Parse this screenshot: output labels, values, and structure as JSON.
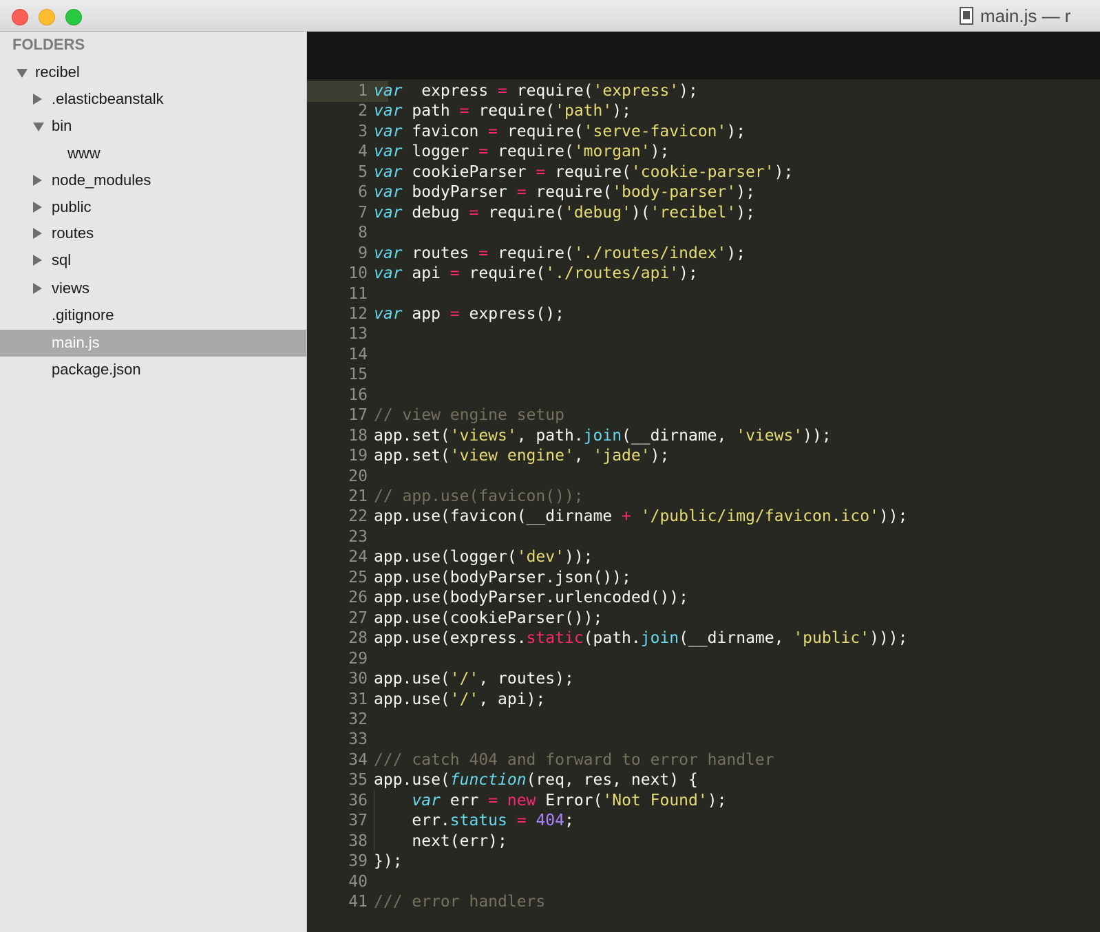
{
  "window": {
    "title": "main.js — r",
    "file_icon": "document-icon"
  },
  "sidebar": {
    "header": "FOLDERS",
    "items": [
      {
        "label": "recibel",
        "type": "folder",
        "expanded": true
      },
      {
        "label": ".elasticbeanstalk",
        "type": "folder",
        "expanded": false
      },
      {
        "label": "bin",
        "type": "folder",
        "expanded": true
      },
      {
        "label": "www",
        "type": "file"
      },
      {
        "label": "node_modules",
        "type": "folder",
        "expanded": false
      },
      {
        "label": "public",
        "type": "folder",
        "expanded": false
      },
      {
        "label": "routes",
        "type": "folder",
        "expanded": false
      },
      {
        "label": "sql",
        "type": "folder",
        "expanded": false
      },
      {
        "label": "views",
        "type": "folder",
        "expanded": false
      },
      {
        "label": ".gitignore",
        "type": "file"
      },
      {
        "label": "main.js",
        "type": "file",
        "selected": true
      },
      {
        "label": "package.json",
        "type": "file"
      }
    ]
  },
  "editor": {
    "theme_colors": {
      "background": "#272822",
      "keyword": "#66d9ef",
      "operator": "#f92672",
      "string": "#e6db74",
      "comment": "#75715e",
      "number": "#ae81ff"
    },
    "current_line": 1,
    "lines": [
      [
        [
          "kw",
          "var"
        ],
        [
          "",
          "  express "
        ],
        [
          "op",
          "="
        ],
        [
          "",
          " require("
        ],
        [
          "str",
          "'express'"
        ],
        [
          "",
          ");"
        ]
      ],
      [
        [
          "kw",
          "var"
        ],
        [
          "",
          " path "
        ],
        [
          "op",
          "="
        ],
        [
          "",
          " require("
        ],
        [
          "str",
          "'path'"
        ],
        [
          "",
          ");"
        ]
      ],
      [
        [
          "kw",
          "var"
        ],
        [
          "",
          " favicon "
        ],
        [
          "op",
          "="
        ],
        [
          "",
          " require("
        ],
        [
          "str",
          "'serve-favicon'"
        ],
        [
          "",
          ");"
        ]
      ],
      [
        [
          "kw",
          "var"
        ],
        [
          "",
          " logger "
        ],
        [
          "op",
          "="
        ],
        [
          "",
          " require("
        ],
        [
          "str",
          "'morgan'"
        ],
        [
          "",
          ");"
        ]
      ],
      [
        [
          "kw",
          "var"
        ],
        [
          "",
          " cookieParser "
        ],
        [
          "op",
          "="
        ],
        [
          "",
          " require("
        ],
        [
          "str",
          "'cookie-parser'"
        ],
        [
          "",
          ");"
        ]
      ],
      [
        [
          "kw",
          "var"
        ],
        [
          "",
          " bodyParser "
        ],
        [
          "op",
          "="
        ],
        [
          "",
          " require("
        ],
        [
          "str",
          "'body-parser'"
        ],
        [
          "",
          ");"
        ]
      ],
      [
        [
          "kw",
          "var"
        ],
        [
          "",
          " debug "
        ],
        [
          "op",
          "="
        ],
        [
          "",
          " require("
        ],
        [
          "str",
          "'debug'"
        ],
        [
          "",
          ")("
        ],
        [
          "str",
          "'recibel'"
        ],
        [
          "",
          ");"
        ]
      ],
      [],
      [
        [
          "kw",
          "var"
        ],
        [
          "",
          " routes "
        ],
        [
          "op",
          "="
        ],
        [
          "",
          " require("
        ],
        [
          "str",
          "'./routes/index'"
        ],
        [
          "",
          ");"
        ]
      ],
      [
        [
          "kw",
          "var"
        ],
        [
          "",
          " api "
        ],
        [
          "op",
          "="
        ],
        [
          "",
          " require("
        ],
        [
          "str",
          "'./routes/api'"
        ],
        [
          "",
          ");"
        ]
      ],
      [],
      [
        [
          "kw",
          "var"
        ],
        [
          "",
          " app "
        ],
        [
          "op",
          "="
        ],
        [
          "",
          " express();"
        ]
      ],
      [],
      [],
      [],
      [],
      [
        [
          "cm",
          "// view engine setup"
        ]
      ],
      [
        [
          "",
          "app.set("
        ],
        [
          "str",
          "'views'"
        ],
        [
          "",
          ", path."
        ],
        [
          "sup",
          "join"
        ],
        [
          "",
          "(__dirname, "
        ],
        [
          "str",
          "'views'"
        ],
        [
          "",
          "));"
        ]
      ],
      [
        [
          "",
          "app.set("
        ],
        [
          "str",
          "'view engine'"
        ],
        [
          "",
          ", "
        ],
        [
          "str",
          "'jade'"
        ],
        [
          "",
          ");"
        ]
      ],
      [],
      [
        [
          "cm",
          "// app.use(favicon());"
        ]
      ],
      [
        [
          "",
          "app.use(favicon(__dirname "
        ],
        [
          "op",
          "+"
        ],
        [
          "",
          " "
        ],
        [
          "str",
          "'/public/img/favicon.ico'"
        ],
        [
          "",
          "));"
        ]
      ],
      [],
      [
        [
          "",
          "app.use(logger("
        ],
        [
          "str",
          "'dev'"
        ],
        [
          "",
          "));"
        ]
      ],
      [
        [
          "",
          "app.use(bodyParser.json());"
        ]
      ],
      [
        [
          "",
          "app.use(bodyParser.urlencoded());"
        ]
      ],
      [
        [
          "",
          "app.use(cookieParser());"
        ]
      ],
      [
        [
          "",
          "app.use(express."
        ],
        [
          "op",
          "static"
        ],
        [
          "",
          "(path."
        ],
        [
          "sup",
          "join"
        ],
        [
          "",
          "(__dirname, "
        ],
        [
          "str",
          "'public'"
        ],
        [
          "",
          ")));"
        ]
      ],
      [],
      [
        [
          "",
          "app.use("
        ],
        [
          "str",
          "'/'"
        ],
        [
          "",
          ", routes);"
        ]
      ],
      [
        [
          "",
          "app.use("
        ],
        [
          "str",
          "'/'"
        ],
        [
          "",
          ", api);"
        ]
      ],
      [],
      [],
      [
        [
          "cm",
          "/// catch 404 and forward to error handler"
        ]
      ],
      [
        [
          "",
          "app.use("
        ],
        [
          "kw",
          "function"
        ],
        [
          "",
          "(req, res, next) {"
        ]
      ],
      [
        [
          "",
          "    "
        ],
        [
          "kw",
          "var"
        ],
        [
          "",
          " err "
        ],
        [
          "op",
          "="
        ],
        [
          "",
          " "
        ],
        [
          "op",
          "new"
        ],
        [
          "",
          " Error("
        ],
        [
          "str",
          "'Not Found'"
        ],
        [
          "",
          ");"
        ]
      ],
      [
        [
          "",
          "    err."
        ],
        [
          "sup",
          "status"
        ],
        [
          "",
          " "
        ],
        [
          "op",
          "="
        ],
        [
          "",
          " "
        ],
        [
          "num",
          "404"
        ],
        [
          "",
          ";"
        ]
      ],
      [
        [
          "",
          "    next(err);"
        ]
      ],
      [
        [
          "",
          "});"
        ]
      ],
      [],
      [
        [
          "cm",
          "/// error handlers"
        ]
      ]
    ]
  }
}
